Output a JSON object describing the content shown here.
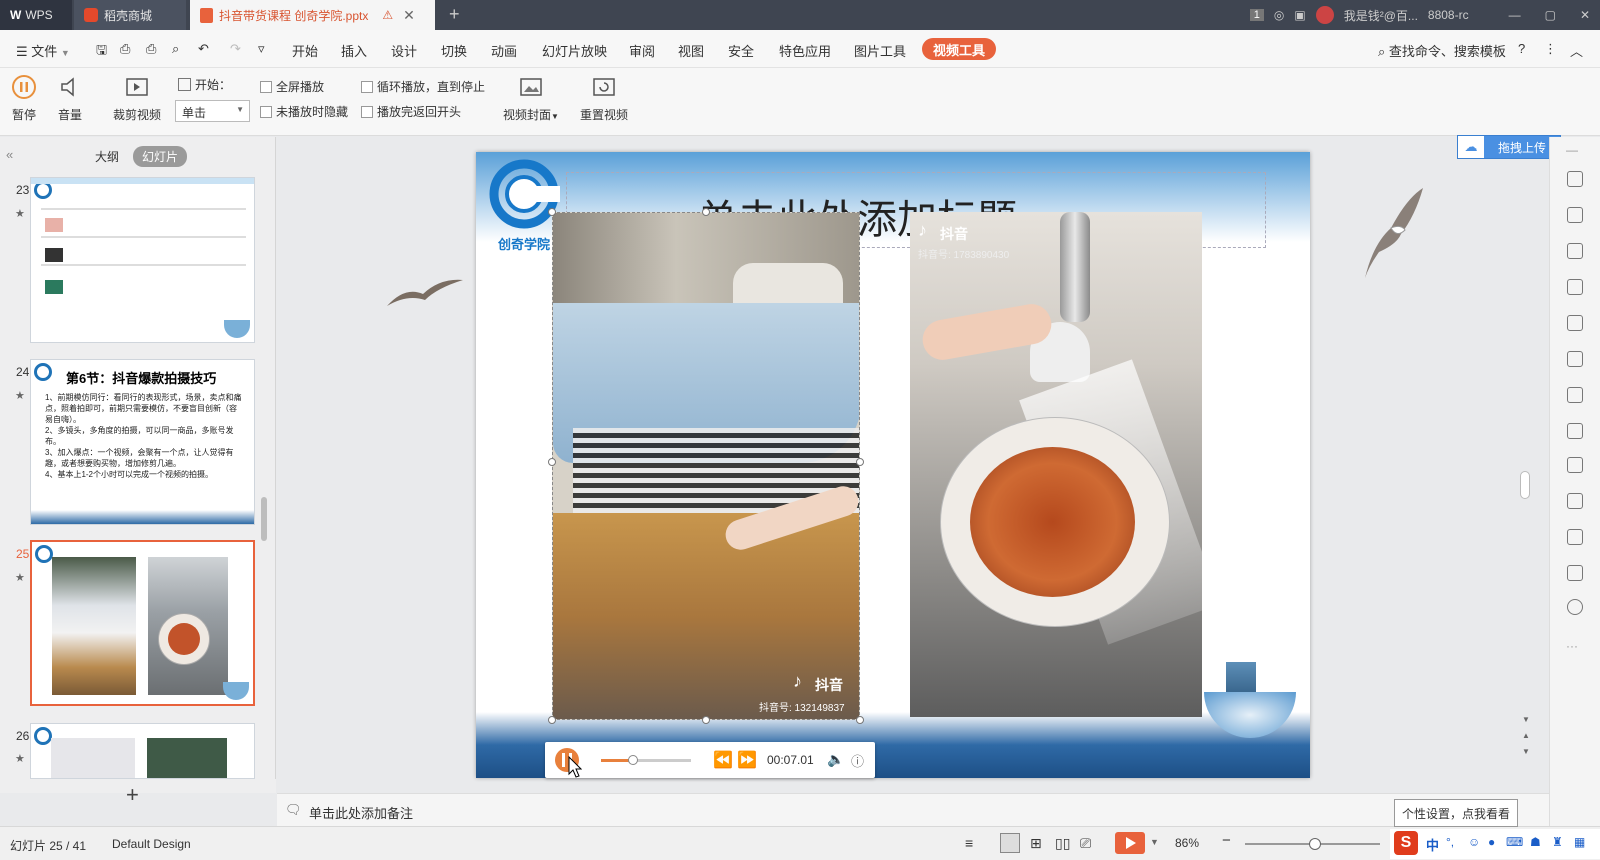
{
  "titlebar": {
    "wps_label": "WPS",
    "tab_mall": "稻壳商城",
    "tab_doc": "抖音带货课程  创奇学院.pptx",
    "count_badge": "1",
    "user_name": "我是钱²@百...",
    "user_id": "8808-rc"
  },
  "menubar": {
    "file": "文件",
    "items": [
      "开始",
      "插入",
      "设计",
      "切换",
      "动画",
      "幻灯片放映",
      "审阅",
      "视图",
      "安全",
      "特色应用",
      "图片工具"
    ],
    "active": "视频工具",
    "search": "查找命令、搜索模板"
  },
  "ribbon": {
    "pause": "暂停",
    "volume": "音量",
    "trim": "裁剪视频",
    "start_label": "开始：",
    "start_value": "单击",
    "fullscreen": "全屏播放",
    "hide_not_playing": "未播放时隐藏",
    "loop": "循环播放，直到停止",
    "rewind": "播放完返回开头",
    "cover": "视频封面",
    "reset": "重置视频"
  },
  "leftpanel": {
    "tab_outline": "大纲",
    "tab_slides": "幻灯片",
    "slides": [
      {
        "num": "23"
      },
      {
        "num": "24",
        "title": "第6节：抖音爆款拍摄技巧",
        "bullets": [
          "1、前期模仿同行：看同行的表现形式，场景，卖点和痛点，照着拍即可，前期只需要模仿，不要盲目创新（容易自嗨）。",
          "2、多镜头，多角度的拍摄，可以同一商品，多账号发布。",
          "3、加入爆点：一个视频，会聚有一个点，让人觉得有趣，或者想要购买物，增加修剪几遍。",
          "4、基本上1-2个小时可以完成一个视频的拍摄。"
        ]
      },
      {
        "num": "25"
      },
      {
        "num": "26"
      }
    ],
    "add_label": "+"
  },
  "slide": {
    "logo_text": "创奇学院",
    "title_placeholder": "单击此处添加标题",
    "video1": {
      "brand": "抖音",
      "account": "抖音号: 132149837"
    },
    "video2": {
      "brand": "抖音",
      "account": "抖音号: 1783890430"
    },
    "player_time": "00:07.01",
    "progress": 0.35
  },
  "notes": {
    "placeholder": "单击此处添加备注"
  },
  "statusbar": {
    "slide_info": "幻灯片 25 / 41",
    "theme": "Default Design",
    "zoom": "86%",
    "tooltip": "个性设置，点我看看",
    "upload": "拖拽上传"
  },
  "ime": {
    "lang": "中"
  }
}
